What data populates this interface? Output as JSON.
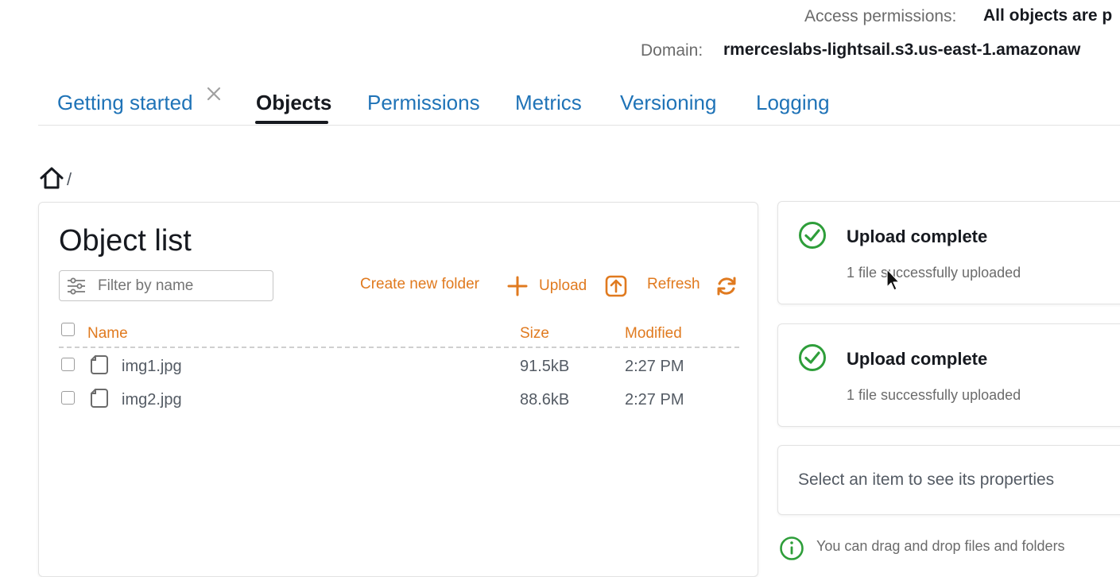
{
  "header": {
    "access_label": "Access permissions:",
    "access_value": "All objects are p",
    "domain_label": "Domain:",
    "domain_value": "rmerceslabs-lightsail.s3.us-east-1.amazonaw"
  },
  "tabs": [
    {
      "label": "Getting started",
      "active": false,
      "closable": true
    },
    {
      "label": "Objects",
      "active": true
    },
    {
      "label": "Permissions",
      "active": false
    },
    {
      "label": "Metrics",
      "active": false
    },
    {
      "label": "Versioning",
      "active": false
    },
    {
      "label": "Logging",
      "active": false
    }
  ],
  "breadcrumb": {
    "separator": "/"
  },
  "object_list": {
    "title": "Object list",
    "filter_placeholder": "Filter by name",
    "actions": {
      "create_folder": "Create new folder",
      "upload": "Upload",
      "refresh": "Refresh"
    },
    "columns": {
      "name": "Name",
      "size": "Size",
      "modified": "Modified"
    },
    "rows": [
      {
        "name": "img1.jpg",
        "size": "91.5kB",
        "modified": "2:27 PM"
      },
      {
        "name": "img2.jpg",
        "size": "88.6kB",
        "modified": "2:27 PM"
      }
    ]
  },
  "notifications": [
    {
      "title": "Upload complete",
      "message": "1 file successfully uploaded"
    },
    {
      "title": "Upload complete",
      "message": "1 file successfully uploaded"
    }
  ],
  "properties_placeholder": "Select an item to see its properties",
  "info_text": "You can drag and drop files and folders",
  "colors": {
    "accent": "#e07a1f",
    "link": "#1f73b7",
    "success": "#2e9e3a"
  },
  "icons": [
    "close-icon",
    "home-icon",
    "filter-icon",
    "plus-icon",
    "upload-icon",
    "refresh-icon",
    "file-icon",
    "check-circle-icon",
    "info-icon",
    "mouse-cursor-icon"
  ]
}
